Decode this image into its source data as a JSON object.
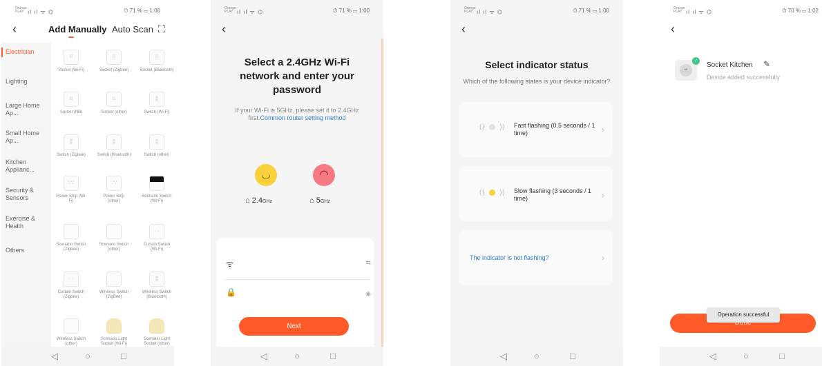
{
  "screens": {
    "s1": {
      "status": {
        "carrier": "Orange PLAY",
        "bars": "ıl ıl ᯤ ⌬",
        "right": "⏱ 71 % ▭ 1:00"
      },
      "tabs": {
        "manual": "Add Manually",
        "auto": "Auto Scan"
      },
      "sidebar": [
        "Electrician",
        "Lighting",
        "Large Home Ap...",
        "Small Home Ap...",
        "Kitchen Applianc...",
        "Security & Sensors",
        "Exercise & Health",
        "Others"
      ],
      "tiles": [
        "Socket (Wi-Fi)",
        "Socket (Zigbee)",
        "Socket (Bluetooth)",
        "Socket (NB)",
        "Socket (other)",
        "Switch (Wi-Fi)",
        "Switch (Zigbee)",
        "Switch (Bluetooth)",
        "Switch (other)",
        "Power Strip (Wi-Fi)",
        "Power Strip (other)",
        "Scenario Switch (Wi-Fi)",
        "Scenario Switch (Zigbee)",
        "Scenario Switch (other)",
        "Curtain Switch (Wi-Fi)",
        "Curtain Switch (Zigbee)",
        "Wireless Switch (ZigBee)",
        "Wireless Switch (Bluetooth)",
        "Wireless Switch (other)",
        "Scenario Light Socket (Wi-Fi)",
        "Scenario Light Socket (other)"
      ]
    },
    "s2": {
      "status": {
        "carrier": "Orange PLAY",
        "bars": "ıl ıl ᯤ ⌬",
        "right": "⏱ 71 % ▭ 1:00"
      },
      "title": "Select a 2.4GHz Wi-Fi network and enter your password",
      "note": "If your Wi-Fi is 5GHz, please set it to 2.4GHz first.",
      "note_link": "Common router setting method",
      "band_good": "2.4",
      "band_bad": "5",
      "band_unit": "GHz",
      "wifi_placeholder": "",
      "password_placeholder": "",
      "next_label": "Next"
    },
    "s3": {
      "status": {
        "carrier": "Orange PLAY",
        "bars": "ıl ıl ᯤ ⌬",
        "right": "⏱ 71 % ▭ 1:00"
      },
      "title": "Select indicator status",
      "subtitle": "Which of the following states is your device indicator?",
      "options": [
        "Fast flashing (0.5 seconds / 1 time)",
        "Slow flashing (3 seconds / 1 time)"
      ],
      "not_flashing": "The indicator is not flashing?"
    },
    "s4": {
      "status": {
        "carrier": "Orange PLAY",
        "bars": "ıl ıl ᯤ ⌬",
        "right": "⏱ 70 % ▭ 1:02"
      },
      "device_name": "Socket Kitchen",
      "device_status": "Device added successfully",
      "done_label": "Done",
      "toast": "Operation successful"
    }
  },
  "icons": {
    "back": "‹",
    "scan": "⛶",
    "wifi": "ᯤ",
    "lock": "🔒",
    "swap": "⇆",
    "eye": "◉",
    "edit": "✎",
    "chevron": "›",
    "nav_back": "◁",
    "nav_home": "○",
    "nav_recent": "□"
  },
  "colors": {
    "accent": "#ff5a28",
    "link": "#2f7bd6",
    "success": "#3cc68a"
  }
}
